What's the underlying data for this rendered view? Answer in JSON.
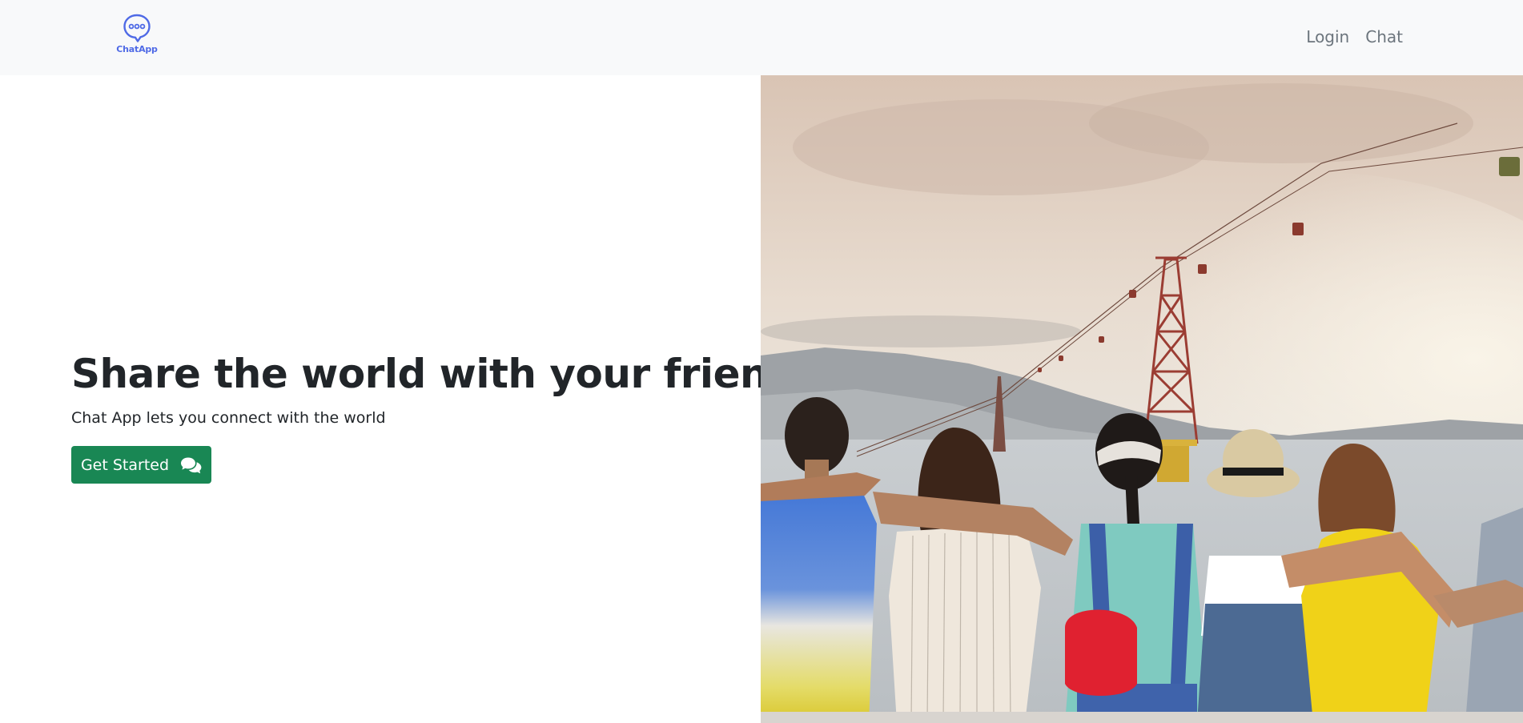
{
  "navbar": {
    "brand_name": "ChatApp",
    "brand_icon": "chat-bubble-icon",
    "links": [
      {
        "label": "Login"
      },
      {
        "label": "Chat"
      }
    ]
  },
  "hero": {
    "title": "Share the world with your friends",
    "subtitle": "Chat App lets you connect with the world",
    "cta_label": "Get Started",
    "cta_icon": "comments-icon",
    "image_alt": "friends sitting arm in arm by the sea watching a cable car"
  },
  "colors": {
    "navbar_bg": "#f8f9fa",
    "brand_blue": "#4f6ae6",
    "cta_green": "#198754",
    "text_dark": "#212529",
    "nav_link_gray": "#6c757d"
  }
}
